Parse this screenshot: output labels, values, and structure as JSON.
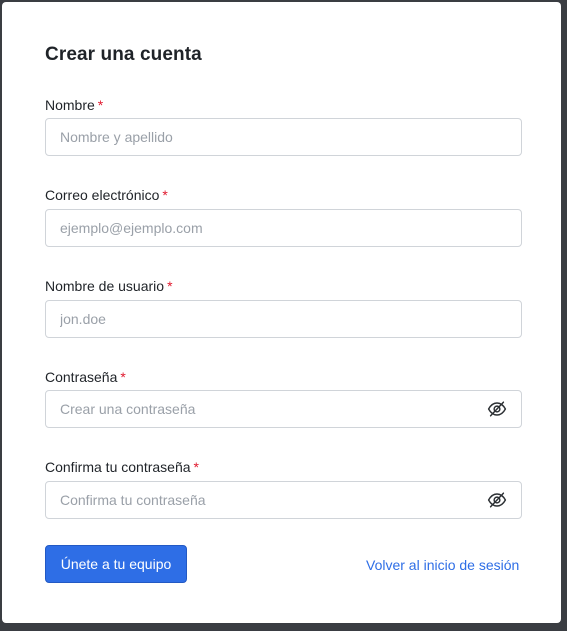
{
  "form": {
    "title": "Crear una cuenta",
    "required_marker": "*",
    "fields": [
      {
        "label": "Nombre",
        "placeholder": "Nombre y apellido",
        "value": "",
        "icon": null
      },
      {
        "label": "Correo electrónico",
        "placeholder": "ejemplo@ejemplo.com",
        "value": "",
        "icon": null
      },
      {
        "label": "Nombre de usuario",
        "placeholder": "jon.doe",
        "value": "",
        "icon": null
      },
      {
        "label": "Contraseña",
        "placeholder": "Crear una contraseña",
        "value": "",
        "icon": "eye-slash-icon"
      },
      {
        "label": "Confirma tu contraseña",
        "placeholder": "Confirma tu contraseña",
        "value": "",
        "icon": "eye-slash-icon"
      }
    ],
    "submit_label": "Únete a tu equipo",
    "back_link_label": "Volver al inicio de sesión"
  },
  "colors": {
    "primary": "#2e6ee6",
    "required": "#e0182d",
    "text": "#1f2328",
    "placeholder": "#9aa0a8",
    "border": "#d0d4d9"
  }
}
